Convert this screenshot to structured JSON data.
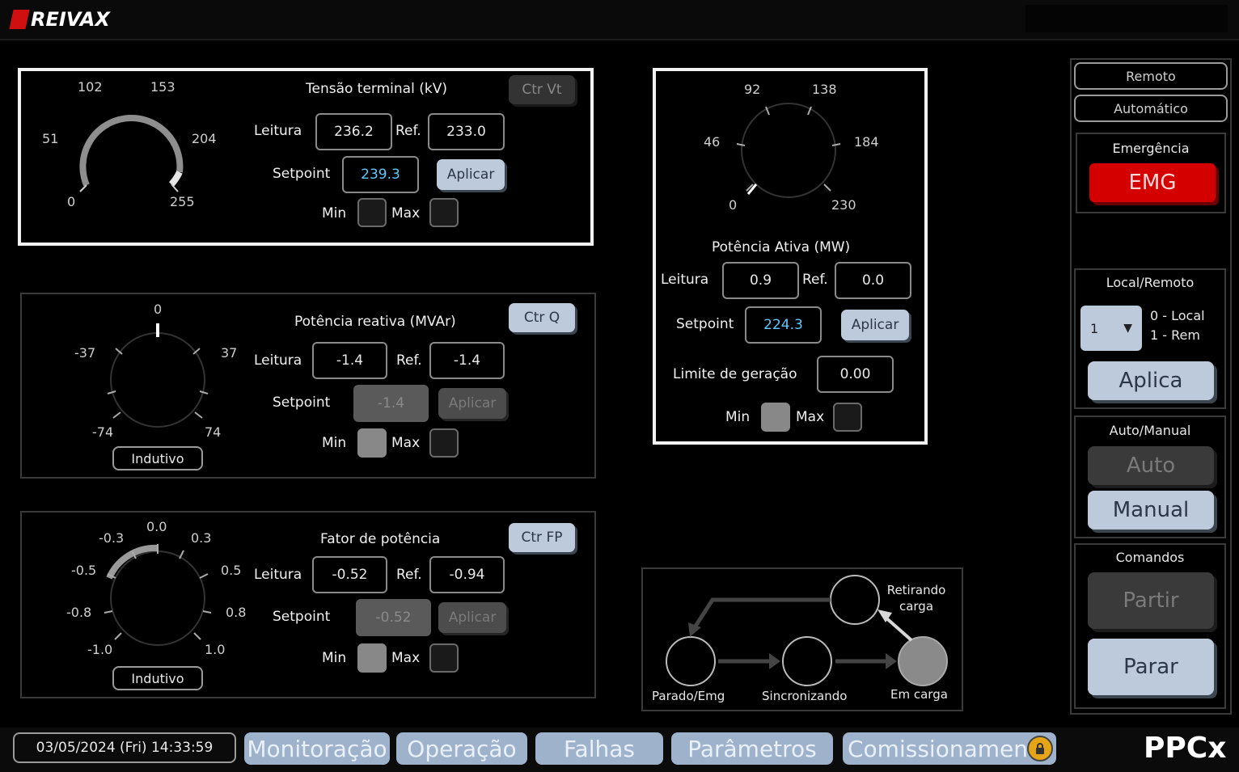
{
  "app": {
    "brand": "REIVAX",
    "product": "PPCx"
  },
  "tensao": {
    "title": "Tensão terminal (kV)",
    "ctr_label": "Ctr Vt",
    "leitura_label": "Leitura",
    "leitura": "236.2",
    "ref_label": "Ref.",
    "ref": "233.0",
    "setpoint_label": "Setpoint",
    "setpoint": "239.3",
    "apply_label": "Aplicar",
    "min_label": "Min",
    "max_label": "Max",
    "gauge_ticks": [
      "0",
      "51",
      "102",
      "153",
      "204",
      "255"
    ],
    "gauge_range": [
      0,
      255
    ],
    "gauge_value": 236.2
  },
  "reativa": {
    "title": "Potência reativa (MVAr)",
    "ctr_label": "Ctr Q",
    "leitura_label": "Leitura",
    "leitura": "-1.4",
    "ref_label": "Ref.",
    "ref": "-1.4",
    "setpoint_label": "Setpoint",
    "setpoint": "-1.4",
    "apply_label": "Aplicar",
    "min_label": "Min",
    "max_label": "Max",
    "gauge_ticks": [
      "-74",
      "-37",
      "0",
      "37",
      "74"
    ],
    "mode": "Indutivo"
  },
  "fp": {
    "title": "Fator de potência",
    "ctr_label": "Ctr FP",
    "leitura_label": "Leitura",
    "leitura": "-0.52",
    "ref_label": "Ref.",
    "ref": "-0.94",
    "setpoint_label": "Setpoint",
    "setpoint": "-0.52",
    "apply_label": "Aplicar",
    "min_label": "Min",
    "max_label": "Max",
    "gauge_ticks": [
      "-1.0",
      "-0.8",
      "-0.5",
      "-0.3",
      "0.0",
      "0.3",
      "0.5",
      "0.8",
      "1.0"
    ],
    "mode": "Indutivo"
  },
  "ativa": {
    "title": "Potência Ativa (MW)",
    "leitura_label": "Leitura",
    "leitura": "0.9",
    "ref_label": "Ref.",
    "ref": "0.0",
    "setpoint_label": "Setpoint",
    "setpoint": "224.3",
    "apply_label": "Aplicar",
    "limite_label": "Limite de geração",
    "limite": "0.00",
    "min_label": "Min",
    "max_label": "Max",
    "gauge_ticks": [
      "0",
      "46",
      "92",
      "138",
      "184",
      "230"
    ]
  },
  "states": {
    "parado": "Parado/Emg",
    "sincronizando": "Sincronizando",
    "em_carga": "Em carga",
    "retirando": "Retirando carga"
  },
  "side": {
    "remoto": "Remoto",
    "automatico": "Automático",
    "emergencia_title": "Emergência",
    "emg": "EMG",
    "local_remoto_title": "Local/Remoto",
    "select_value": "1",
    "legend_0": "0 - Local",
    "legend_1": "1 - Rem",
    "aplica": "Aplica",
    "auto_manual_title": "Auto/Manual",
    "auto": "Auto",
    "manual": "Manual",
    "comandos_title": "Comandos",
    "partir": "Partir",
    "parar": "Parar"
  },
  "nav": {
    "datetime": "03/05/2024 (Fri) 14:33:59",
    "tabs": [
      "Monitoração",
      "Operação",
      "Falhas",
      "Parâmetros",
      "Comissionamen"
    ]
  },
  "colors": {
    "accent_button": "#bccadc",
    "setpoint_text": "#5ec8ff",
    "emergency": "#d40000",
    "lock": "#e6a417"
  }
}
